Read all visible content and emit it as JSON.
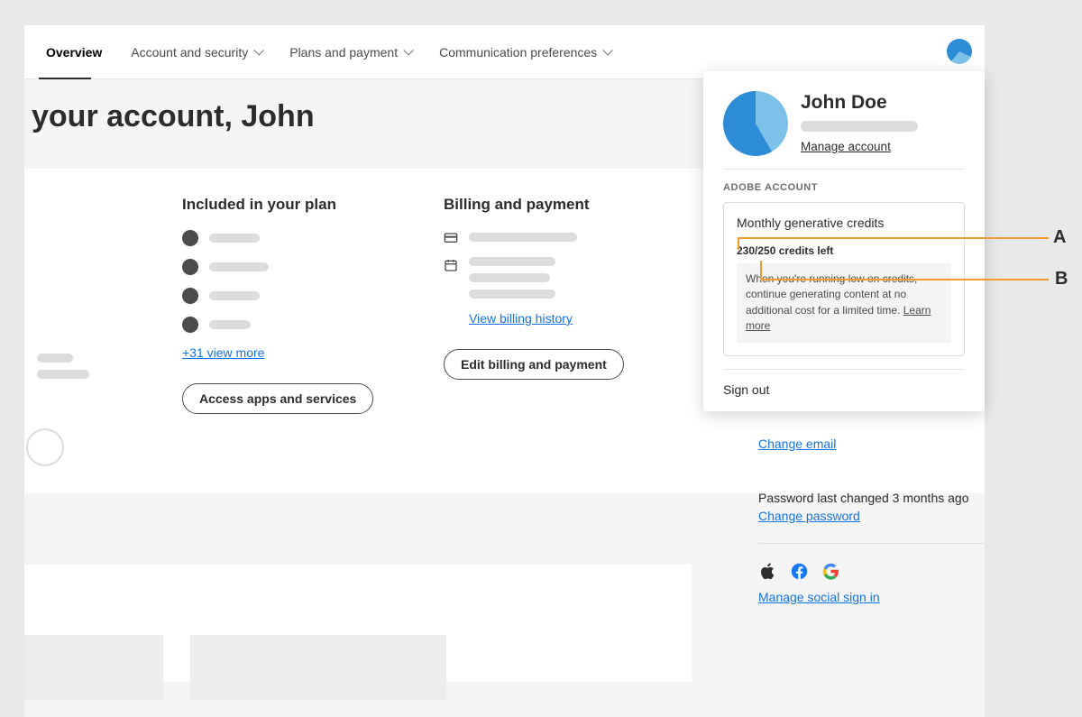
{
  "nav": {
    "overview": "Overview",
    "account_security": "Account and security",
    "plans_payment": "Plans and payment",
    "comm_prefs": "Communication preferences"
  },
  "page_title": "your account, John",
  "plan": {
    "title": "Included in your plan",
    "view_more": "+31 view more",
    "access_btn": "Access apps and services"
  },
  "billing": {
    "title": "Billing and payment",
    "view_history": "View billing history",
    "edit_btn": "Edit billing and payment"
  },
  "right": {
    "change_email": "Change email",
    "password_age": "Password last changed 3 months ago",
    "change_password": "Change password",
    "manage_social": "Manage social sign in"
  },
  "popover": {
    "name": "John Doe",
    "manage": "Manage account",
    "section_label": "ADOBE ACCOUNT",
    "credits_title": "Monthly generative credits",
    "credits_left": "230/250 credits left",
    "credits_note": "When you're running low on credits, continue generating content at no additional cost for a limited time. ",
    "learn_more": "Learn more",
    "sign_out": "Sign out"
  },
  "annotations": {
    "a": "A",
    "b": "B"
  }
}
